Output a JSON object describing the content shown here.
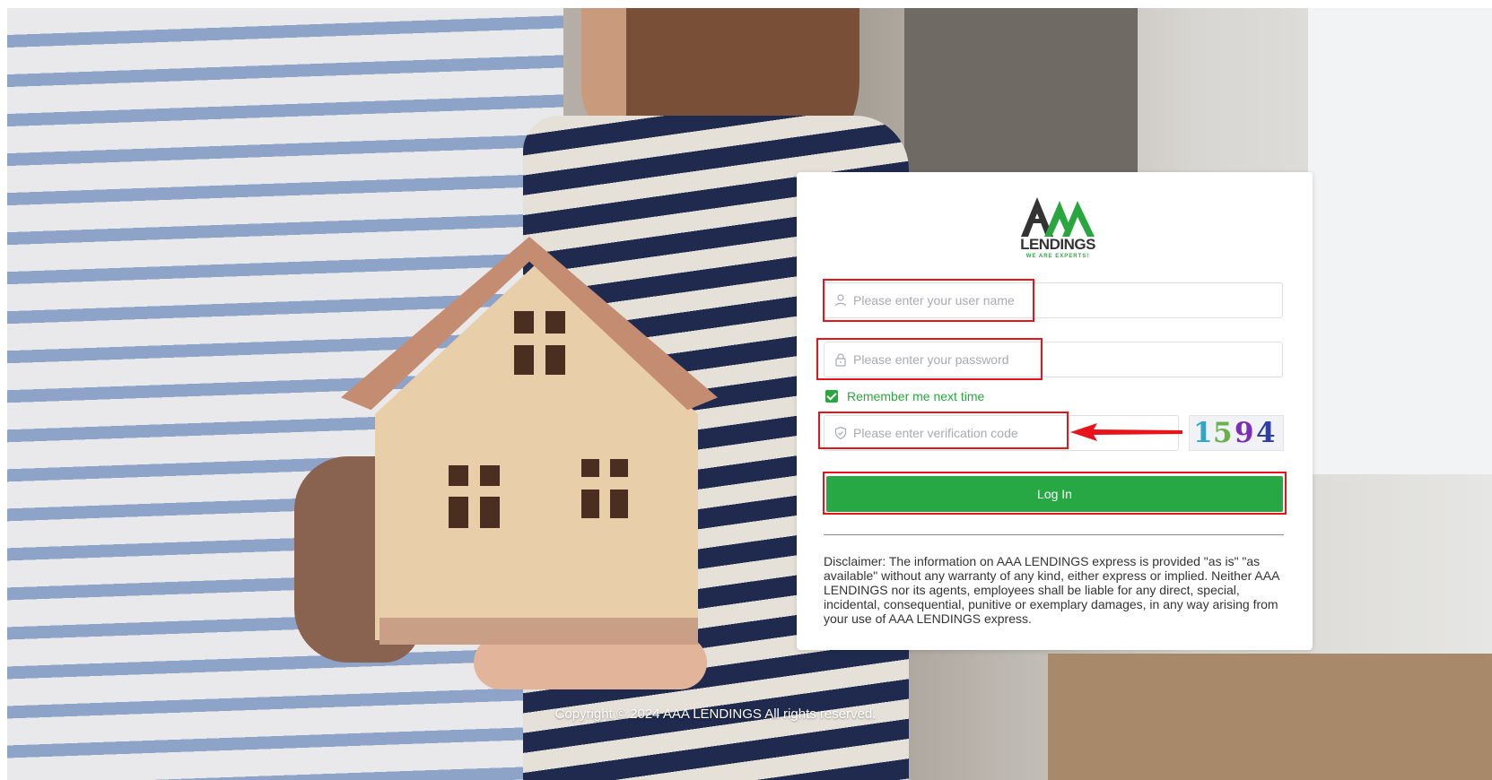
{
  "brand": {
    "logo_text": "LENDINGS",
    "logo_mark": "AAA",
    "tagline": "WE ARE EXPERTS!",
    "accent_color": "#2aa63f"
  },
  "login": {
    "username_placeholder": "Please enter your user name",
    "password_placeholder": "Please enter your password",
    "remember_label": "Remember me next time",
    "remember_checked": true,
    "code_placeholder": "Please enter verification code",
    "captcha_text": "1594",
    "login_button": "Log In",
    "button_color": "#28a745"
  },
  "disclaimer": "Disclaimer: The information on AAA LENDINGS express is provided \"as is\" \"as available\" without any warranty of any kind, either express or implied. Neither AAA LENDINGS nor its agents, employees shall be liable for any direct, special, incidental, consequential, punitive or exemplary damages, in any way arising from your use of AAA LENDINGS express.",
  "footer": {
    "copyright": "Copyright © 2024 AAA LENDINGS All rights reserved."
  },
  "icons": {
    "username": "user-icon",
    "password": "lock-icon",
    "code": "shield-icon"
  }
}
